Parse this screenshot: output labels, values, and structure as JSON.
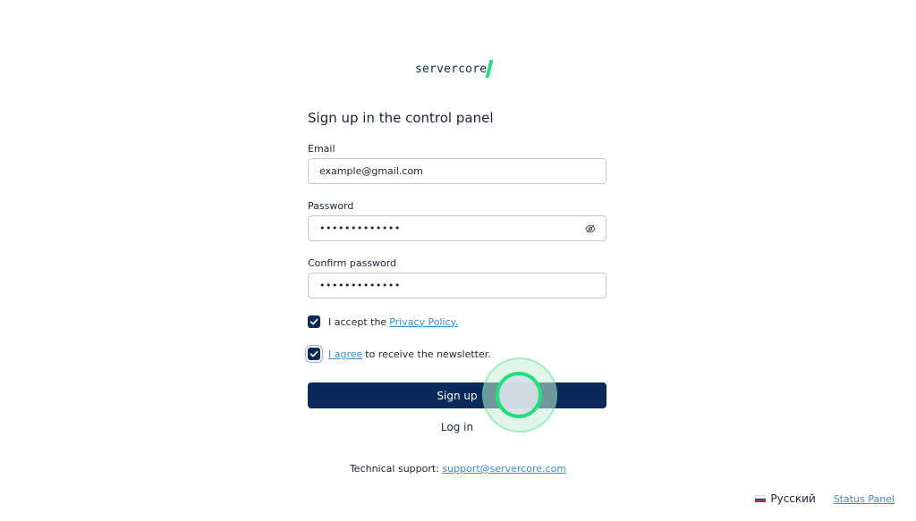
{
  "brand": {
    "logo_text": "servercore"
  },
  "form": {
    "title": "Sign up in the control panel",
    "email": {
      "label": "Email",
      "value": "example@gmail.com"
    },
    "password": {
      "label": "Password",
      "value": "•••••••••••••"
    },
    "confirm_password": {
      "label": "Confirm password",
      "value": "•••••••••••••"
    },
    "privacy": {
      "prefix": "I accept the",
      "link": "Privacy Policy.",
      "checked": true
    },
    "newsletter": {
      "link": "I agree",
      "suffix": "to receive the newsletter.",
      "checked": true
    },
    "signup_label": "Sign up",
    "login_label": "Log in"
  },
  "support": {
    "prefix": "Technical support:",
    "email": "support@servercore.com"
  },
  "footer": {
    "language": "Русский",
    "status_link": "Status Panel"
  },
  "colors": {
    "primary": "#0b2a5b",
    "accent": "#1fe07d",
    "link": "#3b8ad9"
  },
  "icons": {
    "password_toggle": "eye-off-icon",
    "check": "check-icon",
    "flag": "flag-ru-icon"
  }
}
